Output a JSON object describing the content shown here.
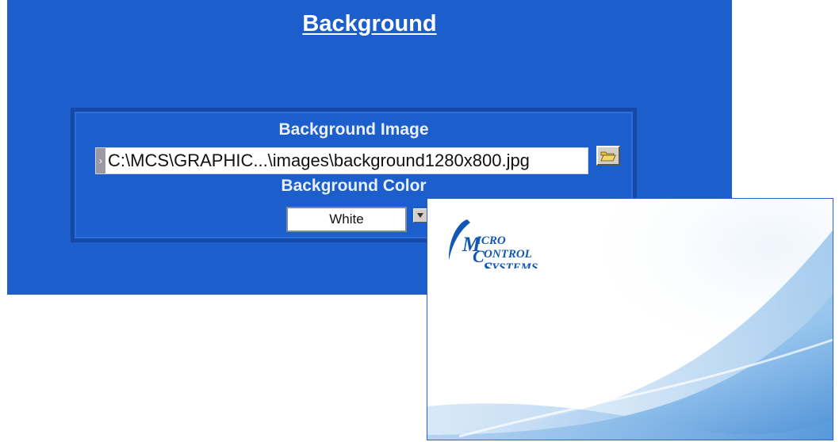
{
  "settings": {
    "title": "Background",
    "image_label": "Background Image",
    "image_path": "C:\\MCS\\GRAPHIC...\\images\\background1280x800.jpg",
    "color_label": "Background Color",
    "color_value": "White"
  },
  "preview": {
    "logo_lines": [
      "ICRO",
      "ONTROL",
      "YSTEMS"
    ],
    "logo_initials": [
      "M",
      "C",
      "S"
    ]
  },
  "colors": {
    "panel_blue": "#1c5ecb",
    "logo_blue": "#1357b5",
    "wave_light": "#dbeaf8",
    "wave_mid": "#7fb4e6",
    "wave_dark": "#3f86d2"
  },
  "icons": {
    "browse": "folder-open-icon",
    "path_prefix": "path-marker-icon",
    "dropdown": "chevron-down-icon"
  }
}
